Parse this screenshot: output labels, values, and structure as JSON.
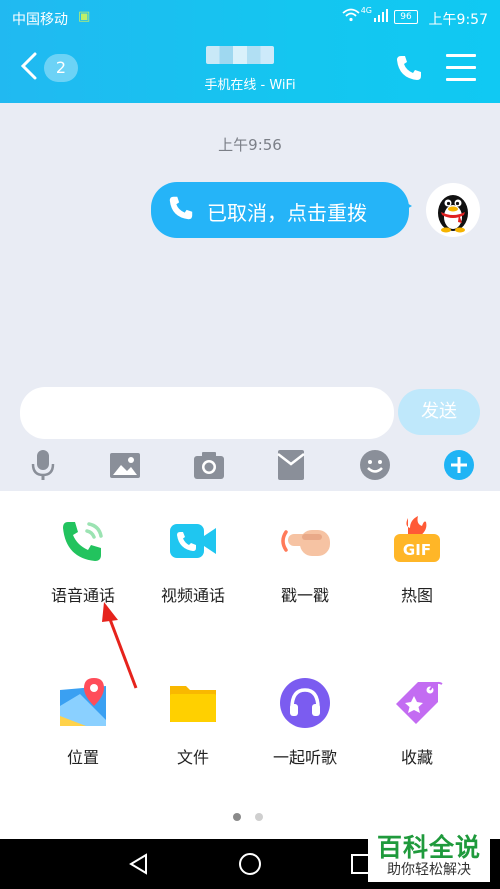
{
  "status_bar": {
    "carrier": "中国移动",
    "battery": "96",
    "time": "上午9:57",
    "network": "4G"
  },
  "header": {
    "unread_count": "2",
    "contact_status": "手机在线 - WiFi"
  },
  "chat": {
    "timestamp": "上午9:56",
    "message": "已取消，点击重拨"
  },
  "input": {
    "placeholder": "",
    "send_label": "发送"
  },
  "toolbar": [
    "mic-icon",
    "image-icon",
    "camera-icon",
    "red-packet-icon",
    "emoji-icon",
    "plus-icon"
  ],
  "panel": {
    "items": [
      {
        "label": "语音通话",
        "icon": "voice-call-icon"
      },
      {
        "label": "视频通话",
        "icon": "video-call-icon"
      },
      {
        "label": "戳一戳",
        "icon": "poke-icon"
      },
      {
        "label": "热图",
        "icon": "gif-icon"
      },
      {
        "label": "位置",
        "icon": "location-icon"
      },
      {
        "label": "文件",
        "icon": "folder-icon"
      },
      {
        "label": "一起听歌",
        "icon": "headphones-icon"
      },
      {
        "label": "收藏",
        "icon": "favorites-icon"
      }
    ],
    "page_indicator": {
      "current": 1,
      "total": 2
    }
  },
  "watermark": {
    "title": "百科全说",
    "subtitle": "助你轻松解决"
  },
  "colors": {
    "header": "#1bbff1",
    "bubble": "#25b4f8",
    "send_disabled": "#bfe8fb",
    "accent": "#1fb4f5"
  }
}
